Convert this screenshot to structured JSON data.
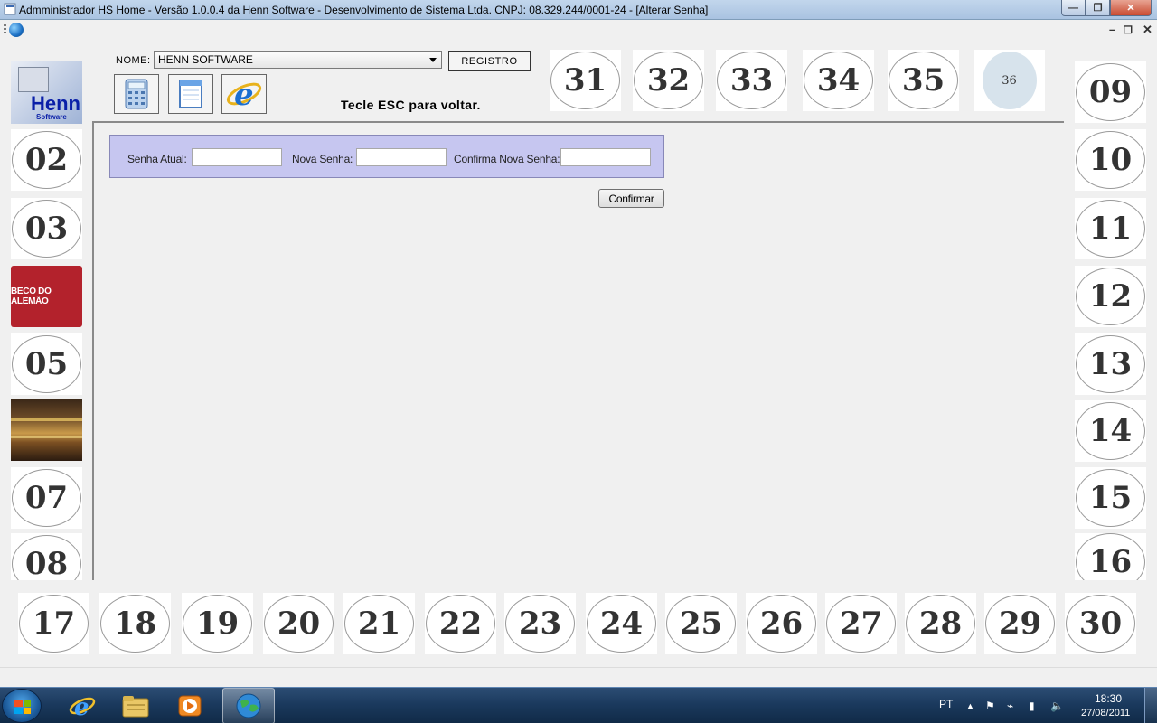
{
  "window": {
    "title": "Admministrador HS Home - Versão 1.0.0.4 da Henn Software - Desenvolvimento de Sistema Ltda. CNPJ: 08.329.244/0001-24 - [Alterar Senha]",
    "minimize_glyph": "—",
    "restore_glyph": "❐",
    "close_glyph": "✕",
    "mdi_minimize_glyph": "–",
    "mdi_restore_glyph": "❐",
    "mdi_close_glyph": "✕"
  },
  "toolbar": {
    "nome_label": "NOME:",
    "nome_value": "HENN SOFTWARE",
    "registro_label": "REGISTRO",
    "esc_hint": "Tecle ESC para voltar.",
    "icons": [
      "calculator-icon",
      "notepad-icon",
      "internet-explorer-icon"
    ]
  },
  "left_tiles": {
    "logo_henn_text": "Henn",
    "logo_henn_sub": "Software",
    "t02": "02",
    "t03": "03",
    "logo_beco_text": "BECO DO ALEMÃO",
    "t05": "05",
    "t07": "07",
    "t08": "08"
  },
  "right_tiles": [
    "09",
    "10",
    "11",
    "12",
    "13",
    "14",
    "15",
    "16"
  ],
  "top_tiles": [
    "31",
    "32",
    "33",
    "34",
    "35",
    "36"
  ],
  "bottom_tiles": [
    "17",
    "18",
    "19",
    "20",
    "21",
    "22",
    "23",
    "24",
    "25",
    "26",
    "27",
    "28",
    "29",
    "30"
  ],
  "password_form": {
    "current_label": "Senha Atual:",
    "new_label": "Nova Senha:",
    "confirm_label": "Confirma Nova Senha:",
    "current_value": "",
    "new_value": "",
    "confirm_value": "",
    "confirm_button": "Confirmar",
    "panel_color": "#c6c6f0"
  },
  "taskbar": {
    "language": "PT",
    "time": "18:30",
    "date": "27/08/2011",
    "pinned": [
      "internet-explorer-icon",
      "windows-explorer-icon",
      "media-player-icon",
      "hs-home-app-icon"
    ]
  }
}
